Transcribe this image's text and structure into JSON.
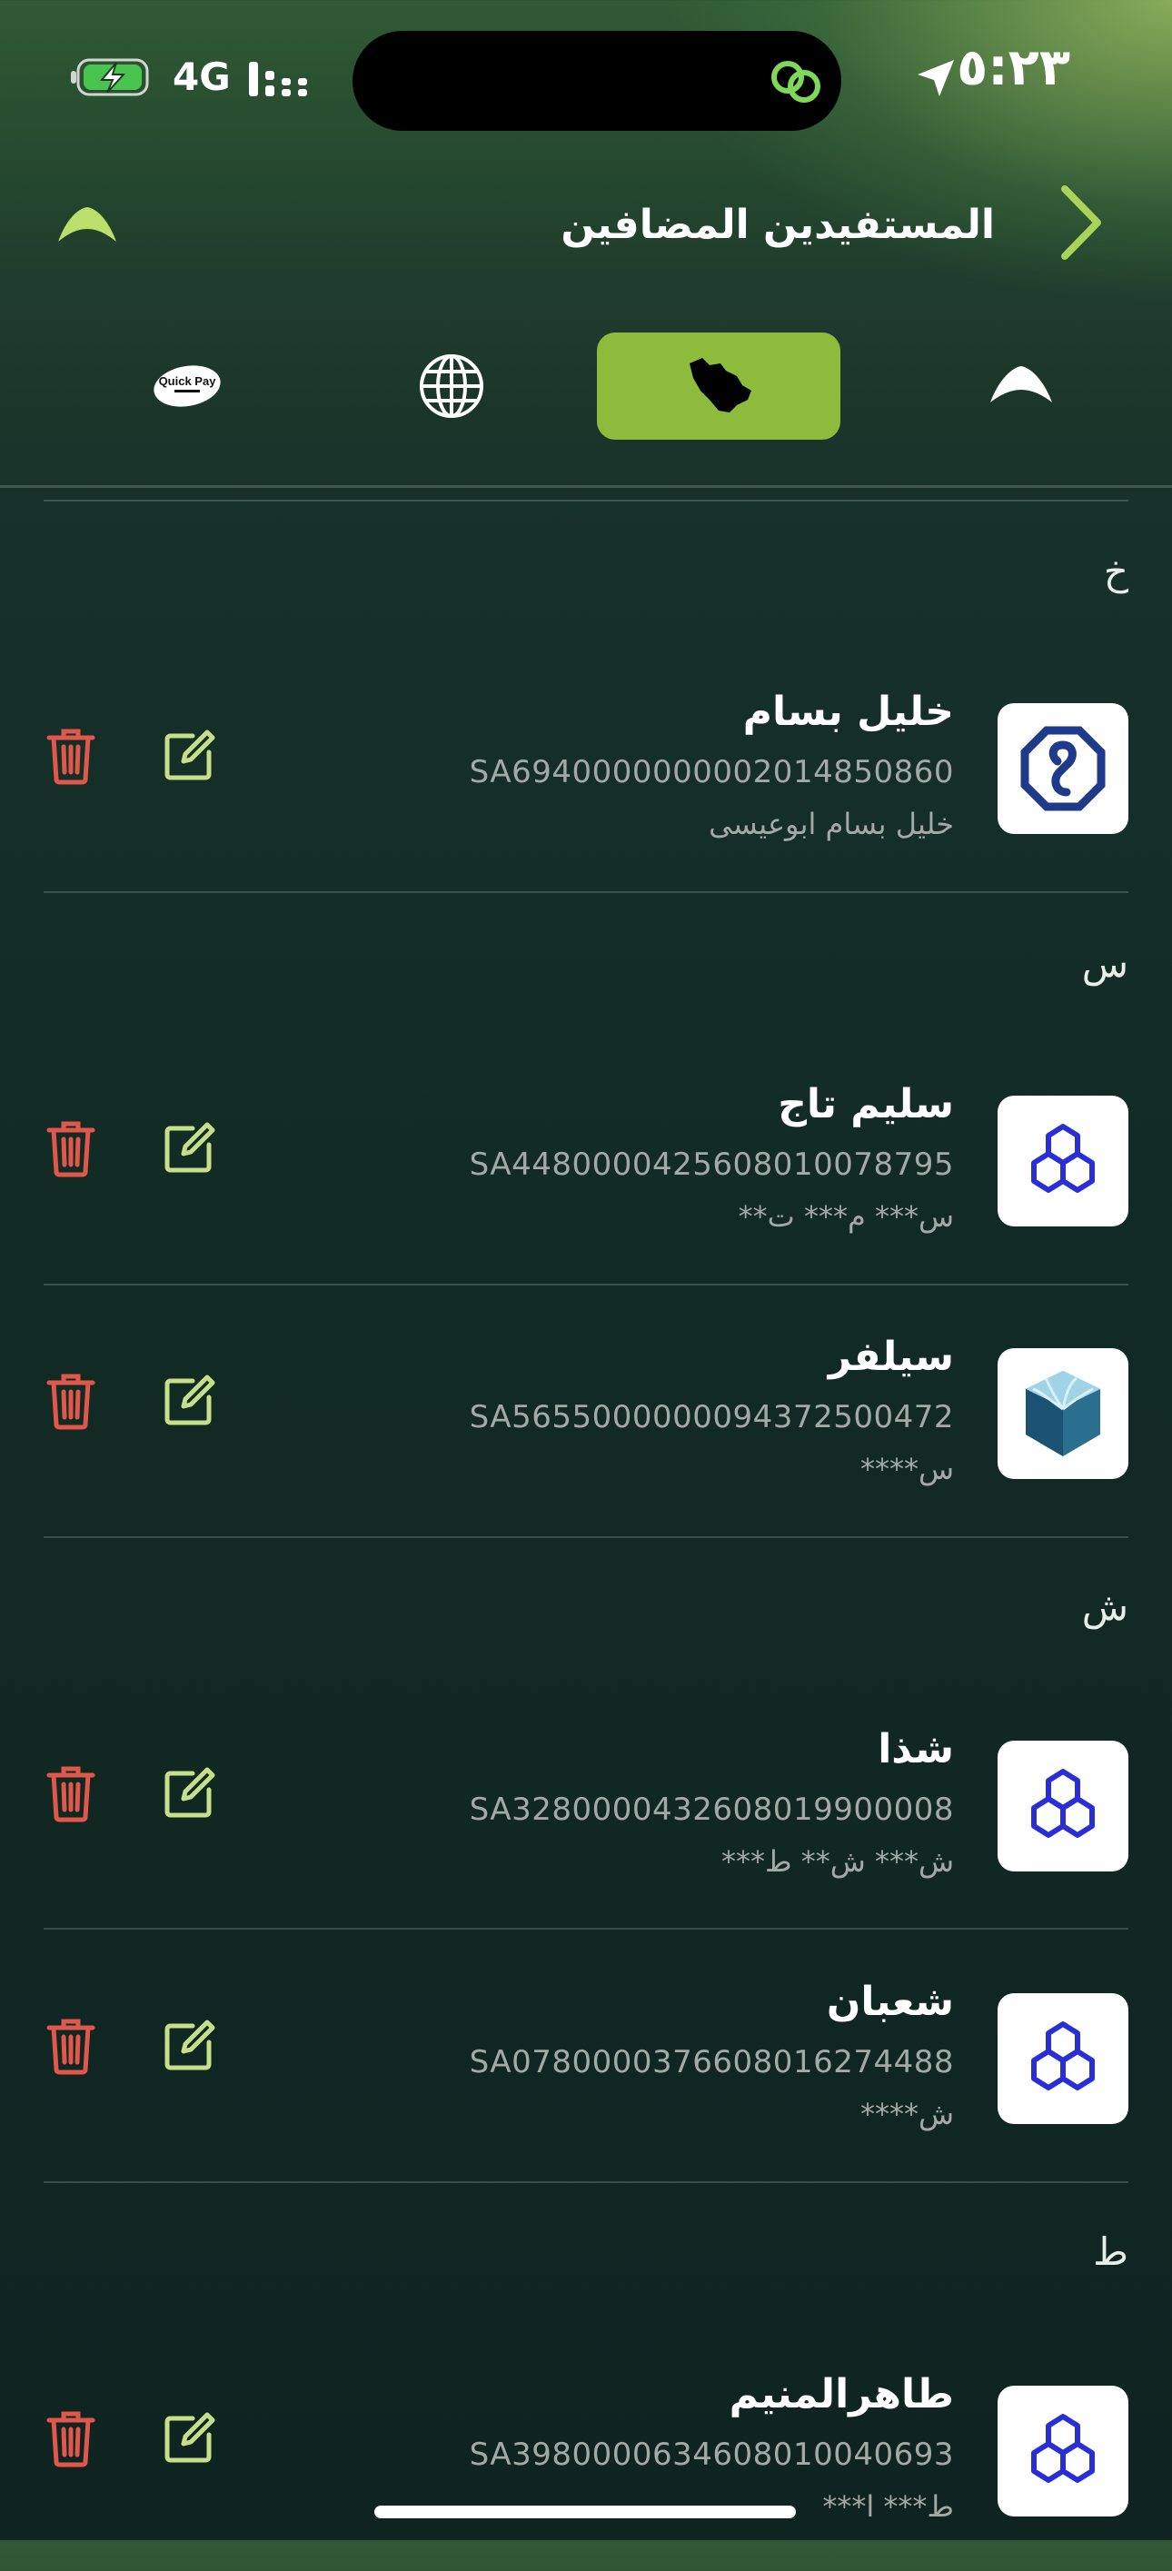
{
  "status_bar": {
    "time": "٥:٢٣",
    "network": "4G",
    "battery_icon": "battery-charging-icon",
    "signal_icon": "signal-bars-icon",
    "location_icon": "location-arrow-icon",
    "island_icon": "link-icon"
  },
  "header": {
    "title": "المستفيدين المضافين",
    "back_icon": "chevron-right-icon",
    "logo_icon": "bank-logo-icon"
  },
  "tabs": [
    {
      "name": "local-bank",
      "icon": "bank-logo-icon",
      "active": false
    },
    {
      "name": "saudi-map",
      "icon": "saudi-map-icon",
      "active": true
    },
    {
      "name": "international",
      "icon": "globe-icon",
      "active": false
    },
    {
      "name": "quick-pay",
      "icon": "quick-pay-icon",
      "active": false,
      "label": "Quick Pay"
    }
  ],
  "sections": [
    {
      "letter": "خ",
      "beneficiaries": [
        {
          "name": "خليل بسام",
          "iban": "SA6940000000002014850860",
          "sub": "خليل بسام ابوعيسى",
          "bank_icon": "alinma-bank-icon"
        }
      ]
    },
    {
      "letter": "س",
      "beneficiaries": [
        {
          "name": "سليم تاج",
          "iban": "SA4480000425608010078795",
          "sub": "س*** م*** ت**",
          "bank_icon": "rajhi-bank-icon"
        },
        {
          "name": "سيلفر",
          "iban": "SA5655000000094372500472",
          "sub": "س****",
          "bank_icon": "jazira-bank-icon"
        }
      ]
    },
    {
      "letter": "ش",
      "beneficiaries": [
        {
          "name": "شذا",
          "iban": "SA3280000432608019900008",
          "sub": "ش*** ش** ط***",
          "bank_icon": "rajhi-bank-icon"
        },
        {
          "name": "شعبان",
          "iban": "SA0780000376608016274488",
          "sub": "ش****",
          "bank_icon": "rajhi-bank-icon"
        }
      ]
    },
    {
      "letter": "ط",
      "beneficiaries": [
        {
          "name": "طاهرالمنيم",
          "iban": "SA3980000634608010040693",
          "sub": "ط*** ا***",
          "bank_icon": "rajhi-bank-icon"
        }
      ]
    }
  ],
  "colors": {
    "accent": "#8dbb3b",
    "edit": "#c6e08a",
    "delete": "#e0574b",
    "rajhi": "#2a2ed6",
    "alinma": "#1f3a8a"
  }
}
